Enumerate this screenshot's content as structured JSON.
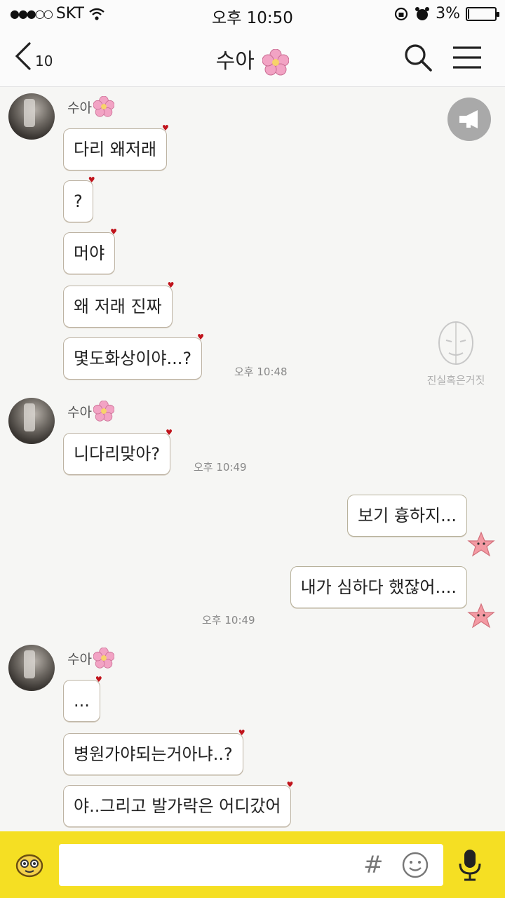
{
  "status_bar": {
    "carrier": "SKT",
    "signal_dots": "●●●○○",
    "time": "오후 10:50",
    "battery": "3%",
    "battery_level": 0.03
  },
  "nav": {
    "back_count": "10",
    "title": "수아",
    "icons": [
      "back-chevron-icon",
      "search-icon",
      "menu-icon"
    ]
  },
  "chat": {
    "sender_name": "수아",
    "watermark": "진실혹은거짓",
    "messages": [
      {
        "side": "in",
        "text": "다리 왜저래"
      },
      {
        "side": "in",
        "text": "?"
      },
      {
        "side": "in",
        "text": "머야"
      },
      {
        "side": "in",
        "text": "왜 저래 진짜"
      },
      {
        "side": "in",
        "text": "몇도화상이야...?",
        "time": "오후 10:48"
      },
      {
        "side": "in",
        "text": "니다리맞아?",
        "time": "오후 10:49"
      },
      {
        "side": "out",
        "text": "보기 흉하지..."
      },
      {
        "side": "out",
        "text": "내가 심하다 했잖어....",
        "time": "오후 10:49"
      },
      {
        "side": "in",
        "text": "..."
      },
      {
        "side": "in",
        "text": "병원가야되는거아냐..?"
      },
      {
        "side": "in",
        "text": "야..그리고 발가락은 어디갔어"
      }
    ]
  },
  "input_bar": {
    "hash_label": "#",
    "placeholder": "",
    "background": "#f5df23"
  }
}
